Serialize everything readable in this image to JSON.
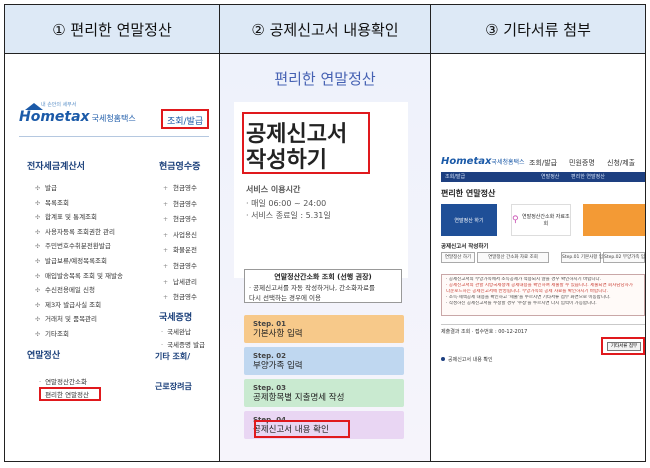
{
  "headers": [
    "① 편리한 연말정산",
    "② 공제신고서 내용확인",
    "③ 기타서류 첨부"
  ],
  "panel1": {
    "logo": "Hometax",
    "logo_sub": "국세청홈택스",
    "logo_tiny": "내 손안의 세무서",
    "menu_selected": "조회/발급",
    "section_einvoice": "전자세금계산서",
    "einvoice_items": [
      "발급",
      "목록조회",
      "합계표 및 통계조회",
      "사용자등록 조회권한 관리",
      "주민번호수취분전환발급",
      "발급보류/예정목록조회",
      "매입발송목록 조회 및 재발송",
      "수신전용메일 신청",
      "제3자 발급사실 조회",
      "거래처 및 품목관리",
      "기타조회"
    ],
    "section_cash": "현금영수증",
    "cash_items": [
      "현금영수",
      "현금영수",
      "현금영수",
      "사업용신",
      "화물운전",
      "현금영수",
      "납세관리",
      "현금영수"
    ],
    "section_tax": "국세증명",
    "tax_items": [
      "국세완납",
      "국세증명 발급"
    ],
    "tax_other": "기타 조회/",
    "section_year": "연말정산",
    "year_items": [
      "연말정산간소화",
      "편리한 연말정산"
    ],
    "section_near": "근로장려금"
  },
  "panel2": {
    "title": "편리한 연말정산",
    "big_title": [
      "공제신고서",
      "작성하기"
    ],
    "service_label": "서비스 이용시간",
    "service_lines": [
      "· 매일 06:00 ~ 24:00",
      "· 서비스 종료일 : 5.31일"
    ],
    "notice_title": "연말정산간소화 조회 (선행 권장)",
    "notice_lines": [
      "· 공제신고서를 자동 작성하거나, 간소화자료를",
      "  다시 선택하는 경우에 이용"
    ],
    "steps": [
      {
        "step": "Step. 01",
        "name": "기본사항 입력"
      },
      {
        "step": "Step. 02",
        "name": "부양가족 입력"
      },
      {
        "step": "Step. 03",
        "name": "공제항목별 지출명세 작성"
      },
      {
        "step": "Step. 04",
        "name": "공제신고서 내용 확인"
      }
    ]
  },
  "panel3": {
    "logo": "Hometax",
    "logo_sub": "국세청홈택스",
    "top_menu": [
      "조회/발급",
      "민원증명",
      "신청/제출"
    ],
    "nav_items": [
      "조회/발급",
      "연말정산",
      "편리한 연말정산"
    ],
    "heading": "편리한 연말정산",
    "tiles": [
      "연말정산 하기",
      "연말정산간소화 자료조회",
      ""
    ],
    "section_label": "공제신고서 작성하기",
    "tabs": [
      "연말정산 하기",
      "연말정산 간소화 자료 조회",
      "Step.01 기본사항 입력",
      "Step.02 부양가족 입력"
    ],
    "notice_lines": [
      "· 공제신고서의 부양가족에서 소득공제가 적용되지 않을 경우 확인하시기 바랍니다.",
      "· 공제신고서의 관할 지방국세청에 공제내용을 확인하여 제출할 수 있습니다. 제출되면 회사담당자가",
      "  다운로드하는 공제신고서에 반영됩니다. 부양가족의 공제 자료를 확인하시기 바랍니다.",
      "· 소득·세액공제 내용을 확인하고 '제출'을 누르시면 기타서류 첨부 화면으로 이동합니다.",
      "· 작성하신 공제신고서를 수정할 경우 '수정'을 누르시면 다시 입력이 가능합니다."
    ],
    "receipt_line": "제출결과 조회 · 접수번호 : 00-12-2017",
    "attach_button": "기타서류 첨부",
    "bottom_item": "공제신고서 내용 확인"
  },
  "colors": {
    "accent_red": "#e0191d",
    "header_bg": "#dde9f6",
    "brand_blue": "#1b5aa8"
  }
}
